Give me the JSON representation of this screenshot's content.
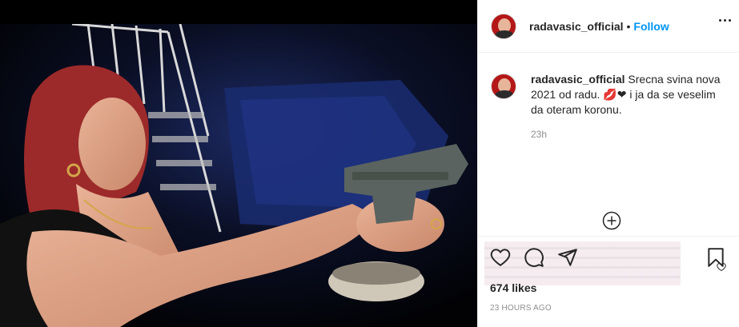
{
  "post": {
    "header": {
      "username": "radavasic_official",
      "separator": "•",
      "follow_label": "Follow"
    },
    "caption": {
      "username": "radavasic_official",
      "text": "Srecna svina nova 2021 od radu. 💋❤ i ja da se veselim da oteram koronu.",
      "time": "23h"
    },
    "likes": "674 likes",
    "posted_ago": "23 HOURS AGO"
  },
  "colors": {
    "accent": "#0095f6",
    "text": "#262626",
    "secondary": "#8e8e8e",
    "avatar_bg": "#b41717"
  },
  "icons": [
    "more-options-icon",
    "load-more-comments-icon",
    "like-heart-icon",
    "comment-icon",
    "share-icon",
    "save-bookmark-icon",
    "comment-like-icon"
  ]
}
